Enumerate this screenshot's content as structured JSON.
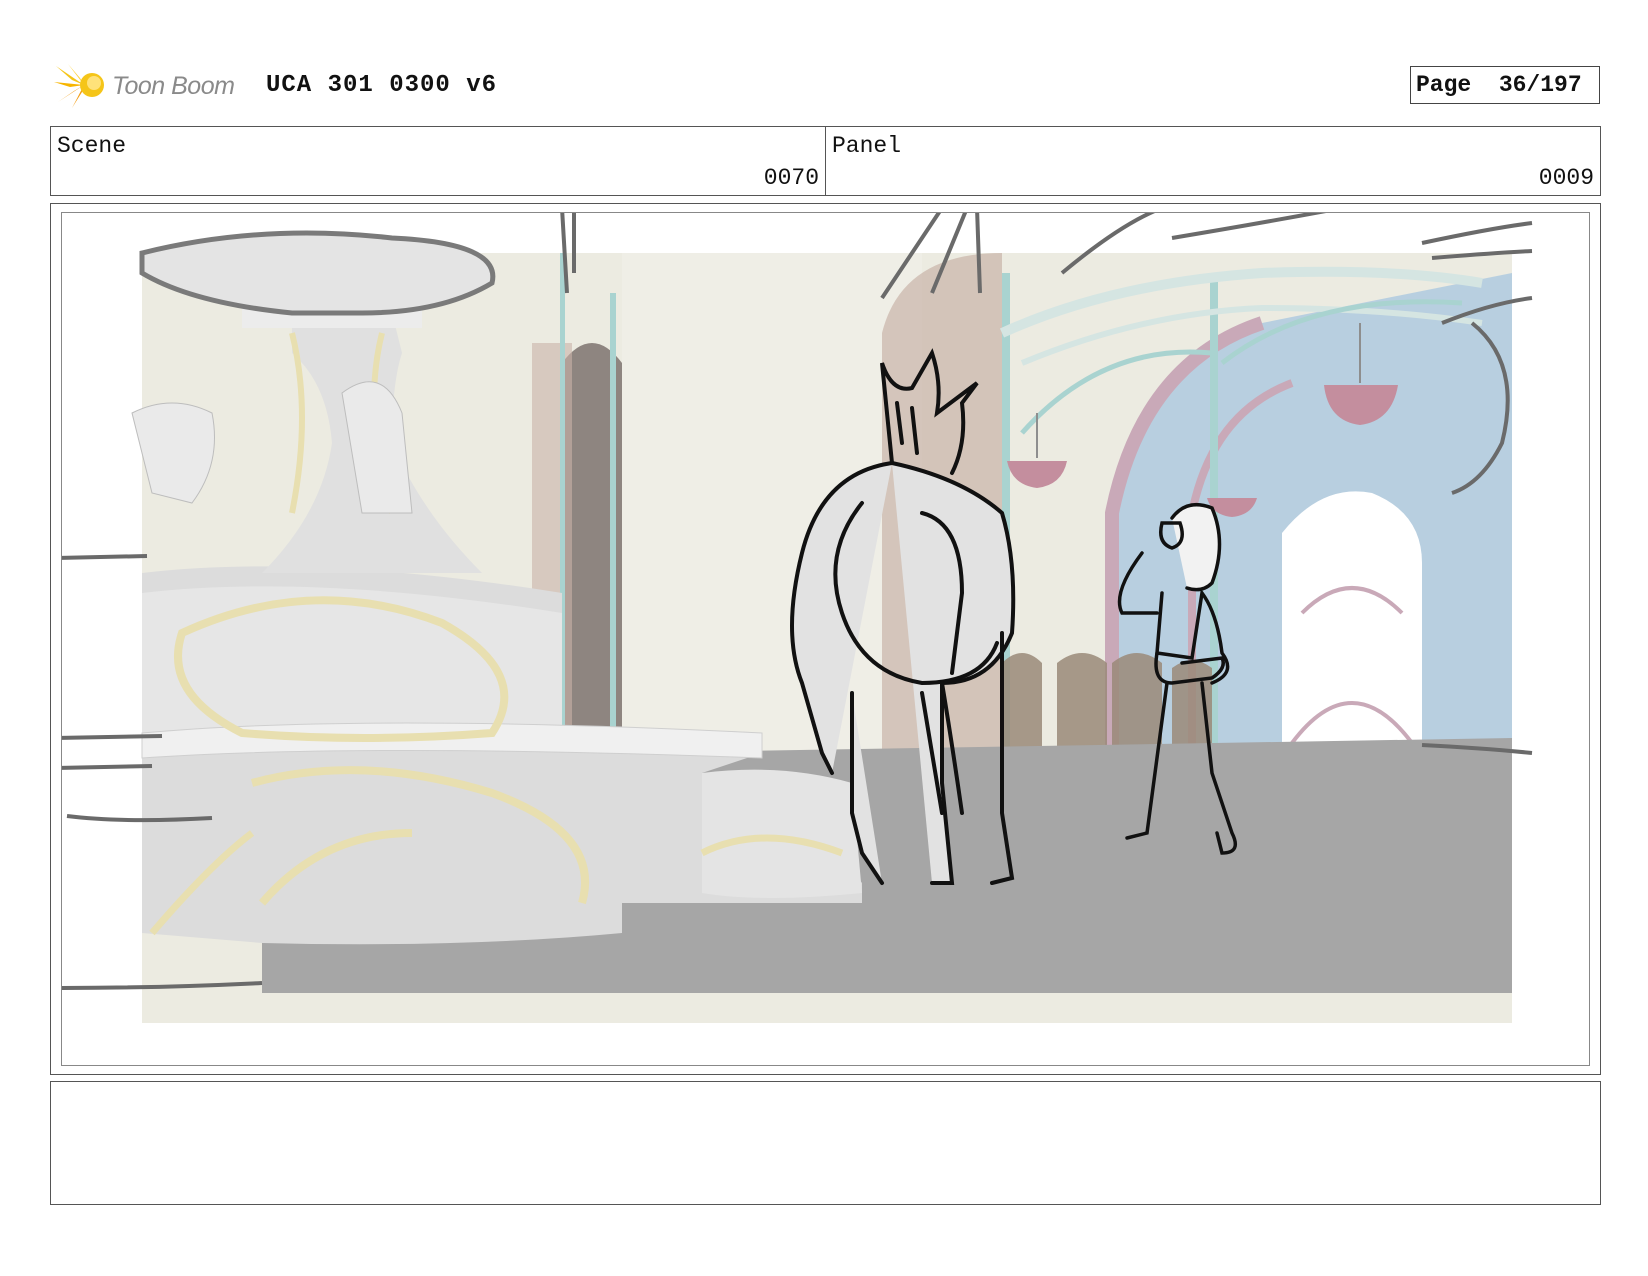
{
  "header": {
    "logo_text": "Toon Boom",
    "doc_title": "UCA 301 0300 v6",
    "page_label": "Page",
    "page_value": "36/197"
  },
  "info": {
    "scene_label": "Scene",
    "scene_value": "0070",
    "panel_label": "Panel",
    "panel_value": "0009"
  },
  "notes": {
    "text": ""
  },
  "colors": {
    "logo_yellow": "#f5c518",
    "logo_orange": "#f39c12",
    "floor_gray": "#a6a6a6",
    "wall_cream": "#ecebe1",
    "window_blue": "#b8cfe0",
    "arch_pink": "#c9a9b8",
    "trim_gold": "#e8dfb0",
    "teal_post": "#a9d3d0"
  },
  "icons": [
    "toonboom-logo-icon"
  ]
}
